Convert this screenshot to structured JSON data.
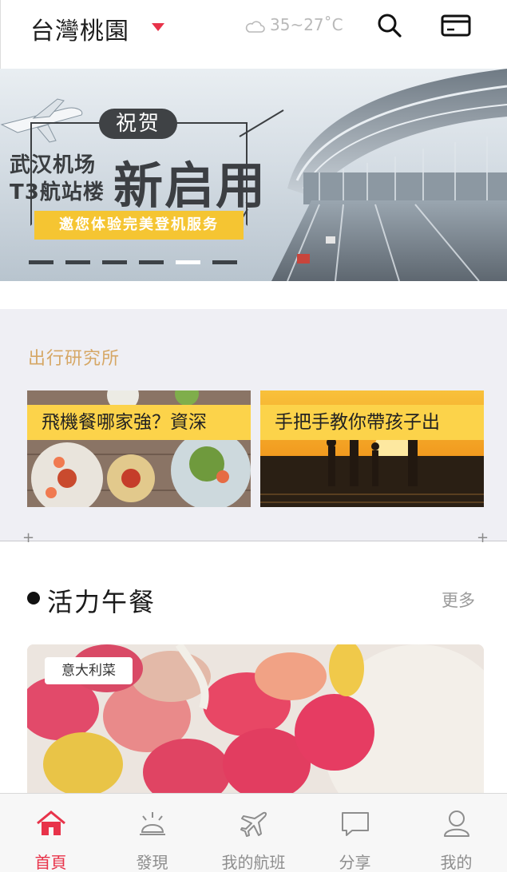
{
  "header": {
    "city": "台灣桃園",
    "weather": "35~27˚C",
    "icons": [
      "cloud-icon",
      "search-icon",
      "card-icon",
      "caret-down-icon"
    ],
    "accent_color": "#e8334a"
  },
  "banner": {
    "badge": "祝贺",
    "line1": "武汉机场",
    "line2": "T3航站楼",
    "headline": "新启用",
    "ribbon": "邀您体验完美登机服务",
    "slide_count": 6,
    "active_slide": 5
  },
  "research": {
    "title": "出行研究所",
    "cards": [
      {
        "caption": "飛機餐哪家強？資深"
      },
      {
        "caption": "手把手教你帶孩子出"
      }
    ]
  },
  "lunch": {
    "title": "活力午餐",
    "more": "更多",
    "tag": "意大利菜"
  },
  "nav": {
    "items": [
      {
        "label": "首頁",
        "icon": "home-icon",
        "active": true
      },
      {
        "label": "發現",
        "icon": "discover-icon",
        "active": false
      },
      {
        "label": "我的航班",
        "icon": "plane-icon",
        "active": false
      },
      {
        "label": "分享",
        "icon": "chat-icon",
        "active": false
      },
      {
        "label": "我的",
        "icon": "user-icon",
        "active": false
      }
    ]
  },
  "colors": {
    "gold_title": "#d6a765",
    "caption_yellow": "#fcd34a",
    "section_bg": "#efeff4"
  }
}
